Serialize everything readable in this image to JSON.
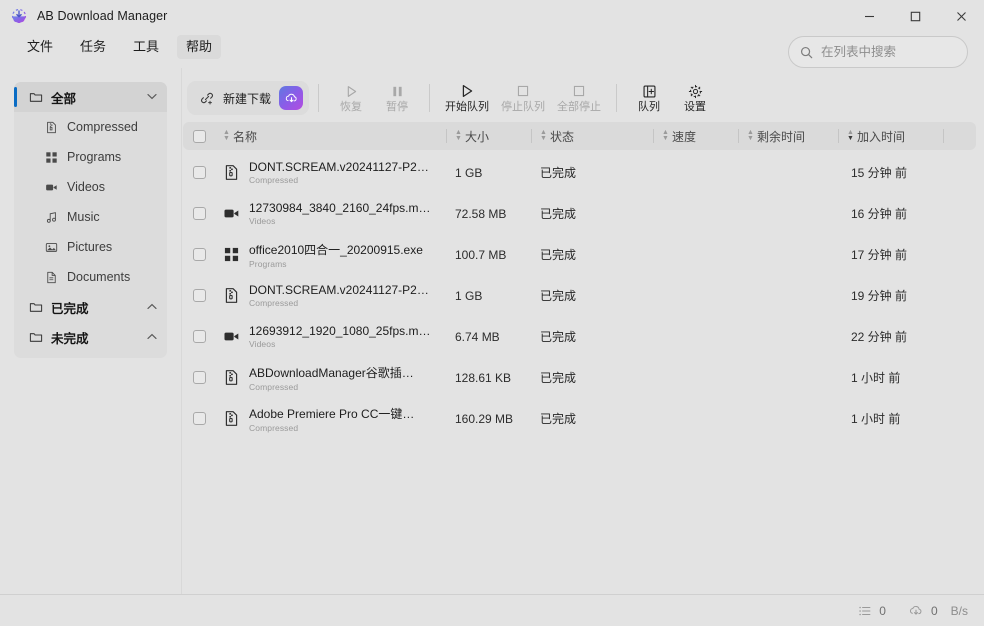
{
  "window": {
    "title": "AB Download Manager",
    "app_icon": "download-circle-icon",
    "controls": {
      "minimize": "─",
      "maximize": "□",
      "close": "✕"
    }
  },
  "menubar": {
    "items": [
      {
        "label": "文件",
        "name": "menu-file",
        "highlighted": false
      },
      {
        "label": "任务",
        "name": "menu-task",
        "highlighted": false
      },
      {
        "label": "工具",
        "name": "menu-tools",
        "highlighted": false
      },
      {
        "label": "帮助",
        "name": "menu-help",
        "highlighted": true
      }
    ]
  },
  "search": {
    "placeholder": "在列表中搜索",
    "value": "",
    "icon": "search-icon"
  },
  "sidebar": {
    "items": [
      {
        "label": "全部",
        "icon": "folder-icon",
        "type": "group",
        "selected": true,
        "chevron": "⌄"
      },
      {
        "label": "Compressed",
        "icon": "archive-icon",
        "type": "child",
        "selected": false
      },
      {
        "label": "Programs",
        "icon": "programs-icon",
        "type": "child",
        "selected": false
      },
      {
        "label": "Videos",
        "icon": "video-icon",
        "type": "child",
        "selected": false
      },
      {
        "label": "Music",
        "icon": "music-icon",
        "type": "child",
        "selected": false
      },
      {
        "label": "Pictures",
        "icon": "image-icon",
        "type": "child",
        "selected": false
      },
      {
        "label": "Documents",
        "icon": "document-icon",
        "type": "child",
        "selected": false
      },
      {
        "label": "已完成",
        "icon": "folder-icon",
        "type": "group",
        "selected": false,
        "chevron": "⌃"
      },
      {
        "label": "未完成",
        "icon": "folder-icon",
        "type": "group",
        "selected": false,
        "chevron": "⌃"
      }
    ]
  },
  "toolbar": {
    "new_download": {
      "label": "新建下载",
      "icon": "link-plus-icon",
      "accent_button_icon": "cloud-download-icon"
    },
    "buttons": [
      {
        "label": "恢复",
        "icon": "play-icon",
        "enabled": false,
        "name": "resume-button"
      },
      {
        "label": "暂停",
        "icon": "pause-icon",
        "enabled": false,
        "name": "pause-button"
      },
      {
        "label": "开始队列",
        "icon": "play-icon",
        "enabled": true,
        "name": "start-queue-button"
      },
      {
        "label": "停止队列",
        "icon": "stop-icon",
        "enabled": false,
        "name": "stop-queue-button"
      },
      {
        "label": "全部停止",
        "icon": "stop-icon",
        "enabled": false,
        "name": "stop-all-button"
      },
      {
        "label": "队列",
        "icon": "queue-icon",
        "enabled": true,
        "name": "queue-button"
      },
      {
        "label": "设置",
        "icon": "gear-icon",
        "enabled": true,
        "name": "settings-button"
      }
    ]
  },
  "table": {
    "headers": [
      {
        "label": "名称",
        "sorted": false
      },
      {
        "label": "大小",
        "sorted": false
      },
      {
        "label": "状态",
        "sorted": false
      },
      {
        "label": "速度",
        "sorted": false
      },
      {
        "label": "剩余时间",
        "sorted": false
      },
      {
        "label": "加入时间",
        "sorted": true
      }
    ],
    "rows": [
      {
        "name": "DONT.SCREAM.v20241127-P2…",
        "category": "Compressed",
        "icon": "archive-icon",
        "size": "1 GB",
        "status": "已完成",
        "speed": "",
        "remaining": "",
        "added": "15 分钟 前"
      },
      {
        "name": "12730984_3840_2160_24fps.m…",
        "category": "Videos",
        "icon": "video-icon",
        "size": "72.58 MB",
        "status": "已完成",
        "speed": "",
        "remaining": "",
        "added": "16 分钟 前"
      },
      {
        "name": "office2010四合一_20200915.exe",
        "category": "Programs",
        "icon": "programs-icon",
        "size": "100.7 MB",
        "status": "已完成",
        "speed": "",
        "remaining": "",
        "added": "17 分钟 前"
      },
      {
        "name": "DONT.SCREAM.v20241127-P2…",
        "category": "Compressed",
        "icon": "archive-icon",
        "size": "1 GB",
        "status": "已完成",
        "speed": "",
        "remaining": "",
        "added": "19 分钟 前"
      },
      {
        "name": "12693912_1920_1080_25fps.m…",
        "category": "Videos",
        "icon": "video-icon",
        "size": "6.74 MB",
        "status": "已完成",
        "speed": "",
        "remaining": "",
        "added": "22 分钟 前"
      },
      {
        "name": "ABDownloadManager谷歌插…",
        "category": "Compressed",
        "icon": "archive-icon",
        "size": "128.61 KB",
        "status": "已完成",
        "speed": "",
        "remaining": "",
        "added": "1 小时 前"
      },
      {
        "name": "Adobe Premiere Pro CC一键…",
        "category": "Compressed",
        "icon": "archive-icon",
        "size": "160.29 MB",
        "status": "已完成",
        "speed": "",
        "remaining": "",
        "added": "1 小时 前"
      }
    ]
  },
  "statusbar": {
    "task_count": "0",
    "task_icon": "list-icon",
    "speed_value": "0",
    "speed_icon": "cloud-download-icon",
    "speed_unit": "B/s"
  },
  "colors": {
    "background": "#e3e3e3",
    "sidebar_card": "#dcdcdc",
    "accent_blue": "#0a6cc4",
    "accent_gradient_start": "#5f7ae0",
    "accent_gradient_end": "#b44ce0",
    "text_primary": "#1d1d1d",
    "text_muted": "#9a9a9a"
  }
}
